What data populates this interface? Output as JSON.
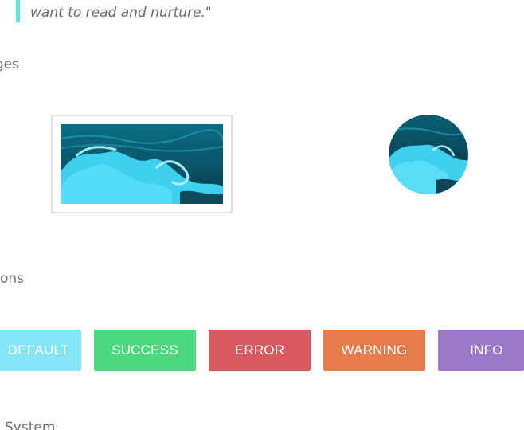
{
  "quote": {
    "text": "want to read and nurture.\"",
    "accent_color": "#5fe7cf"
  },
  "sections": {
    "images_heading": "ges",
    "buttons_heading": "ons",
    "system_heading": "System"
  },
  "images": {
    "framed_image_icon": "ocean-wave-photo",
    "circle_image_icon": "ocean-wave-photo"
  },
  "buttons": [
    {
      "label": "DEFAULT",
      "color": "#84e5f7"
    },
    {
      "label": "SUCCESS",
      "color": "#4cd87c"
    },
    {
      "label": "ERROR",
      "color": "#d95a5e"
    },
    {
      "label": "WARNING",
      "color": "#e77c4b"
    },
    {
      "label": "INFO",
      "color": "#9c78c9"
    }
  ]
}
